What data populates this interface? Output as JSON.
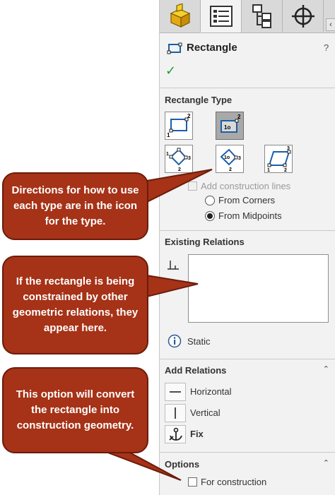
{
  "panel": {
    "title": "Rectangle",
    "help_glyph": "?",
    "ok_glyph": "✓",
    "tabs": [
      {
        "icon": "part-feature-manager-icon",
        "active": false
      },
      {
        "icon": "property-manager-icon",
        "active": true
      },
      {
        "icon": "configuration-manager-icon",
        "active": false
      },
      {
        "icon": "dimxpert-crosshair-icon",
        "active": false
      }
    ],
    "tab_scroll_glyph": "‹"
  },
  "sections": {
    "rectangle_type": {
      "title": "Rectangle Type",
      "add_construction_lines": "Add construction lines",
      "from_corners": "From Corners",
      "from_midpoints": "From Midpoints",
      "selected_radio": "from_midpoints"
    },
    "existing_relations": {
      "title": "Existing Relations",
      "status": "Static"
    },
    "add_relations": {
      "title": "Add Relations",
      "items": [
        "Horizontal",
        "Vertical",
        "Fix"
      ]
    },
    "options": {
      "title": "Options",
      "for_construction": "For construction"
    }
  },
  "callouts": [
    {
      "text": "Directions for how to use each type are in the icon for the type."
    },
    {
      "text": "If the rectangle is being constrained by other geometric relations, they appear here."
    },
    {
      "text": "This option will convert the rectangle into construction geometry."
    }
  ],
  "colors": {
    "callout_fill": "#a63217",
    "callout_border": "#6b1c0b",
    "ok_green": "#1e9a3a",
    "panel_bg": "#f2f2f2"
  },
  "caret_glyph": "⌃"
}
